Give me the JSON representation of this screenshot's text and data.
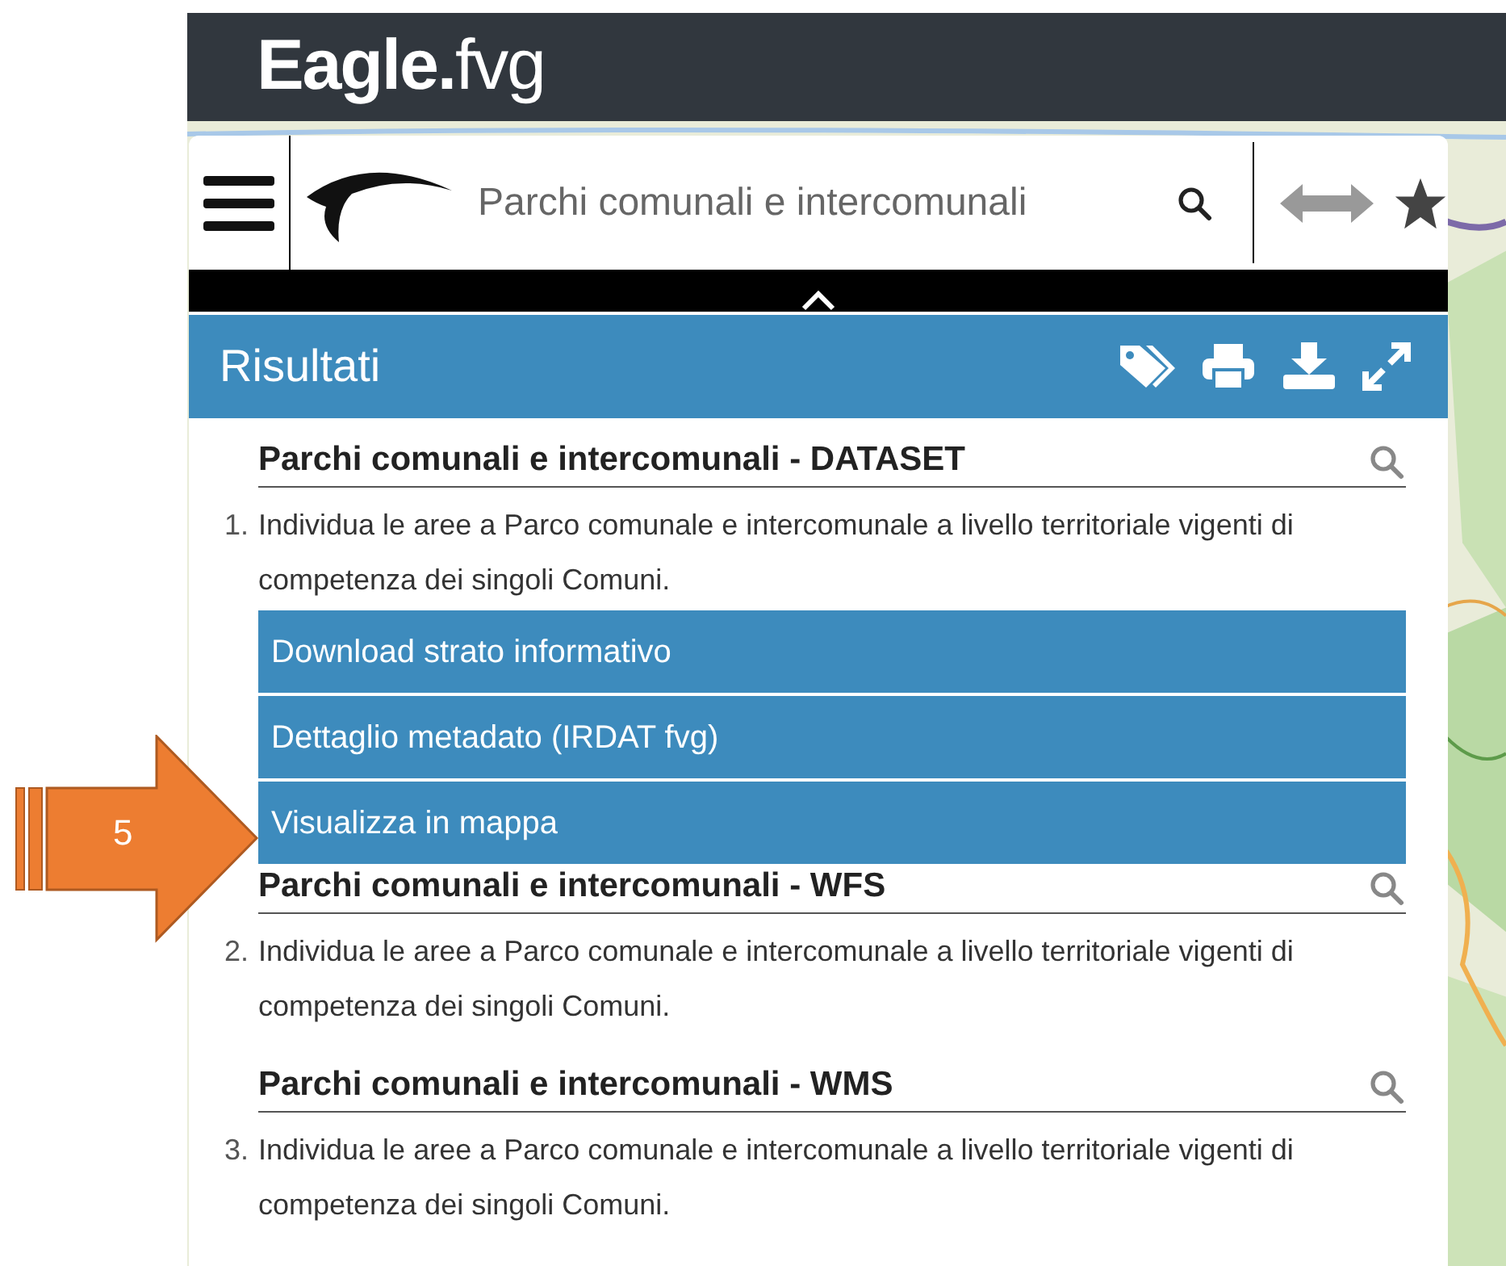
{
  "header": {
    "logo_bold": "Eagle.",
    "logo_light": "fvg"
  },
  "search": {
    "value": "Parchi comunali e intercomunali"
  },
  "results_panel": {
    "title": "Risultati"
  },
  "results": [
    {
      "title": "Parchi comunali e intercomunali - DATASET",
      "number": "1.",
      "description": "Individua le aree a Parco comunale e intercomunale a livello territoriale vigenti di competenza dei singoli Comuni.",
      "links": [
        "Download strato informativo",
        "Dettaglio metadato (IRDAT fvg)",
        "Visualizza in mappa"
      ]
    },
    {
      "title": "Parchi comunali e intercomunali - WFS",
      "number": "2.",
      "description": "Individua le aree a Parco comunale e intercomunale a livello territoriale vigenti di competenza dei singoli Comuni."
    },
    {
      "title": "Parchi comunali e intercomunali - WMS",
      "number": "3.",
      "description": "Individua le aree a Parco comunale e intercomunale a livello territoriale vigenti di competenza dei singoli Comuni."
    }
  ],
  "callout": {
    "label": "5"
  }
}
